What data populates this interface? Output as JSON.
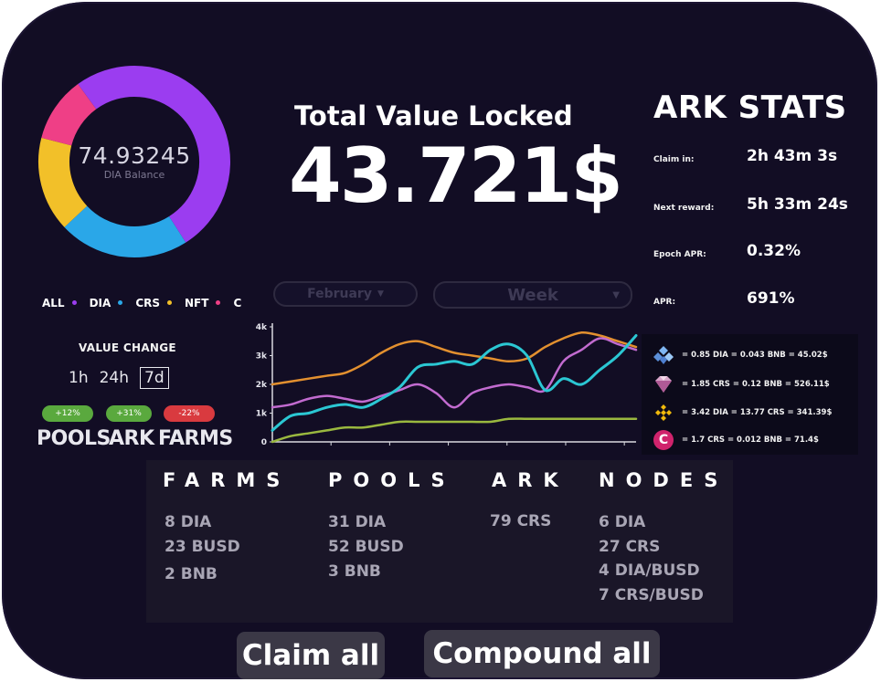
{
  "donut": {
    "value": "74.93245",
    "label": "DIA Balance",
    "segments": [
      {
        "name": "DIA",
        "share": 0.41,
        "color": "#9b3df0"
      },
      {
        "name": "CRS",
        "share": 0.22,
        "color": "#2aa7e8"
      },
      {
        "name": "NFT",
        "share": 0.16,
        "color": "#f2c029"
      },
      {
        "name": "C",
        "share": 0.11,
        "color": "#ef3f86"
      },
      {
        "name": "DIA",
        "share": 0.1,
        "color": "#9b3df0"
      }
    ]
  },
  "legend": [
    {
      "label": "ALL",
      "color": "#9b3df0"
    },
    {
      "label": "DIA",
      "color": "#2aa7e8"
    },
    {
      "label": "CRS",
      "color": "#f2c029"
    },
    {
      "label": "NFT",
      "color": "#ef3f86"
    },
    {
      "label": "C",
      "color": ""
    }
  ],
  "value_change": {
    "title": "VALUE CHANGE",
    "timeframes": [
      "1h",
      "24h",
      "7d"
    ],
    "active": "7d",
    "badges": {
      "pools": "+12%",
      "ark": "+31%",
      "farms": "-22%"
    },
    "categories": {
      "pools": "POOLS",
      "ark": "ARK",
      "farms": "FARMS"
    }
  },
  "tvl": {
    "title": "Total Value Locked",
    "value": "43.721$"
  },
  "filters": {
    "month": "February",
    "period": "Week"
  },
  "chart_data": {
    "type": "line",
    "ylim": [
      0,
      4
    ],
    "yticks": [
      "0",
      "1k",
      "2k",
      "3k",
      "4k"
    ],
    "x": [
      0,
      1,
      2,
      3,
      4,
      5,
      6,
      7,
      8,
      9,
      10,
      11,
      12,
      13,
      14,
      15,
      16,
      17,
      18,
      19,
      20
    ],
    "series": [
      {
        "color": "#e3902f",
        "values": [
          2.0,
          2.1,
          2.2,
          2.3,
          2.4,
          2.7,
          3.1,
          3.4,
          3.5,
          3.3,
          3.1,
          3.0,
          2.9,
          2.8,
          2.9,
          3.3,
          3.6,
          3.8,
          3.7,
          3.5,
          3.3
        ]
      },
      {
        "color": "#c26bd0",
        "values": [
          1.2,
          1.3,
          1.5,
          1.6,
          1.5,
          1.4,
          1.6,
          1.8,
          2.0,
          1.7,
          1.2,
          1.7,
          1.9,
          2.0,
          1.9,
          1.8,
          2.8,
          3.2,
          3.6,
          3.4,
          3.2
        ]
      },
      {
        "color": "#2bc7d3",
        "values": [
          0.4,
          0.9,
          1.0,
          1.2,
          1.3,
          1.2,
          1.5,
          1.9,
          2.6,
          2.7,
          2.8,
          2.7,
          3.2,
          3.4,
          3.0,
          1.8,
          2.2,
          2.0,
          2.5,
          3.0,
          3.7
        ]
      },
      {
        "color": "#9ab83f",
        "values": [
          0.0,
          0.2,
          0.3,
          0.4,
          0.5,
          0.5,
          0.6,
          0.7,
          0.7,
          0.7,
          0.7,
          0.7,
          0.7,
          0.8,
          0.8,
          0.8,
          0.8,
          0.8,
          0.8,
          0.8,
          0.8
        ]
      }
    ]
  },
  "ark_stats": {
    "title": "ARK STATS",
    "rows": [
      {
        "label": "Claim in:",
        "value": "2h 43m 3s"
      },
      {
        "label": "Next reward:",
        "value": "5h 33m 24s"
      },
      {
        "label": "Epoch APR:",
        "value": "0.32%"
      },
      {
        "label": "APR:",
        "value": "691%"
      }
    ],
    "rates": [
      {
        "icon": "diamond-cluster-icon",
        "text": "= 0.85 DIA = 0.043 BNB = 45.02$"
      },
      {
        "icon": "gem-icon",
        "text": "= 1.85 CRS = 0.12 BNB = 526.11$"
      },
      {
        "icon": "bnb-coin-icon",
        "text": "= 3.42 DIA = 13.77 CRS = 341.39$"
      },
      {
        "icon": "c-coin-icon",
        "icon_text": "C",
        "text": "= 1.7 CRS = 0.012 BNB = 71.4$"
      }
    ]
  },
  "holdings": {
    "farms": {
      "title": "FARMS",
      "items": [
        "8 DIA",
        "23 BUSD",
        "2 BNB"
      ]
    },
    "pools": {
      "title": "POOLS",
      "items": [
        "31 DIA",
        "52 BUSD",
        "3 BNB"
      ]
    },
    "ark": {
      "title": "ARK",
      "items": [
        "79 CRS"
      ]
    },
    "nodes": {
      "title": "NODES",
      "items": [
        "6 DIA",
        "27 CRS",
        "4 DIA/BUSD",
        "7 CRS/BUSD"
      ]
    }
  },
  "actions": {
    "claim_all": "Claim all",
    "compound_all": "Compound all"
  }
}
